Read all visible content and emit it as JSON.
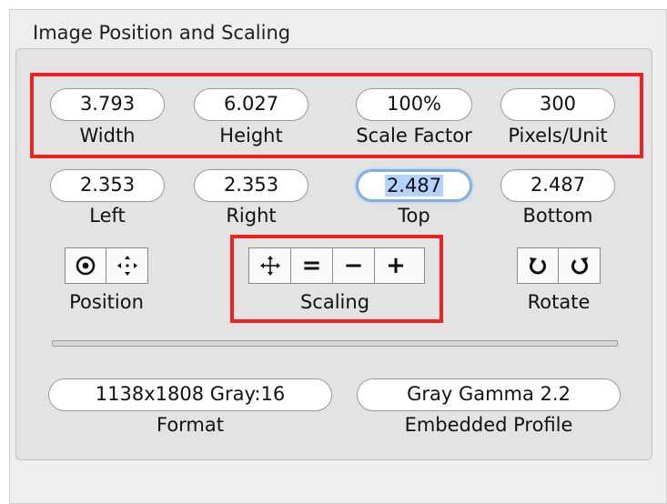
{
  "panel": {
    "title": "Image Position and Scaling"
  },
  "size_fields": [
    {
      "value": "3.793",
      "label": "Width"
    },
    {
      "value": "6.027",
      "label": "Height"
    },
    {
      "value": "100%",
      "label": "Scale Factor"
    },
    {
      "value": "300",
      "label": "Pixels/Unit"
    }
  ],
  "margin_fields": [
    {
      "value": "2.353",
      "label": "Left"
    },
    {
      "value": "2.353",
      "label": "Right"
    },
    {
      "value": "2.487",
      "label": "Top",
      "focused": true
    },
    {
      "value": "2.487",
      "label": "Bottom"
    }
  ],
  "position": {
    "label": "Position",
    "buttons": [
      "center-target-icon",
      "move-arrows-icon"
    ]
  },
  "scaling": {
    "label": "Scaling",
    "buttons": [
      "fit-arrows-icon",
      "=",
      "−",
      "+"
    ]
  },
  "rotate": {
    "label": "Rotate",
    "buttons": [
      "rotate-left-icon",
      "rotate-right-icon"
    ]
  },
  "info_fields": [
    {
      "value": "1138x1808 Gray:16",
      "label": "Format"
    },
    {
      "value": "Gray Gamma 2.2",
      "label": "Embedded Profile"
    }
  ],
  "colors": {
    "highlight": "#ee2222",
    "focus_ring": "#7fb0e8",
    "selection": "#b4d3fb"
  }
}
